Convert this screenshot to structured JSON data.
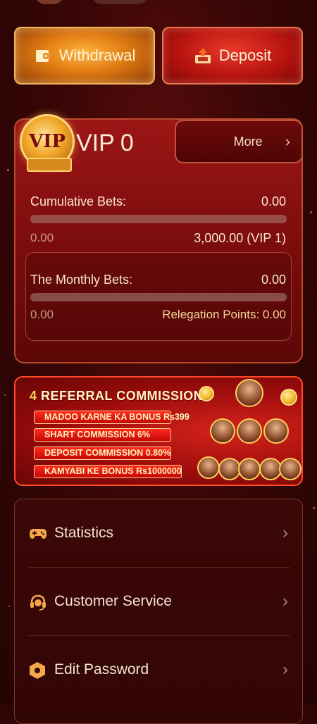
{
  "actions": {
    "withdraw_label": "Withdrawal",
    "deposit_label": "Deposit"
  },
  "vip": {
    "badge_text": "VIP",
    "level_prefix": "VIP",
    "level": "0",
    "more_label": "More",
    "cumulative_label": "Cumulative Bets:",
    "cumulative_value": "0.00",
    "cumulative_progress": 0,
    "cumulative_min": "0.00",
    "cumulative_target": "3,000.00 (VIP 1)",
    "monthly_label": "The Monthly Bets:",
    "monthly_value": "0.00",
    "monthly_progress": 0,
    "monthly_min": "0.00",
    "relegation": "Relegation Points: 0.00"
  },
  "referral": {
    "title_number": "4",
    "title_text": " REFERRAL COMMISSION",
    "lines": [
      "MADOO KARNE KA BONUS Rs399",
      "SHART COMMISSION 6%",
      "DEPOSIT COMMISSION 0.80%",
      "KAMYABI KE BONUS Rs1000000"
    ]
  },
  "menu": [
    {
      "label": "Statistics",
      "icon": "gamepad-icon"
    },
    {
      "label": "Customer Service",
      "icon": "headset-icon"
    },
    {
      "label": "Edit Password",
      "icon": "hexagon-lock-icon"
    }
  ],
  "colors": {
    "accent_gold": "#f4b65a",
    "deposit_red": "#b8140f",
    "background": "#3a0606"
  }
}
